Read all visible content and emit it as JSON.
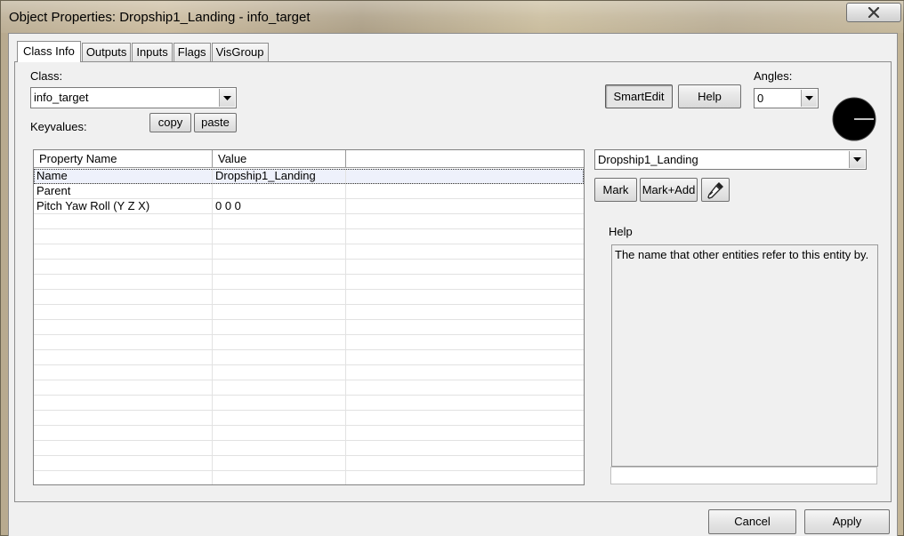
{
  "window": {
    "title": "Object Properties: Dropship1_Landing - info_target",
    "close_label": "close"
  },
  "tabs": [
    {
      "label": "Class Info",
      "active": true
    },
    {
      "label": "Outputs",
      "active": false
    },
    {
      "label": "Inputs",
      "active": false
    },
    {
      "label": "Flags",
      "active": false
    },
    {
      "label": "VisGroup",
      "active": false
    }
  ],
  "class_info": {
    "class_label": "Class:",
    "class_value": "info_target",
    "keyvalues_label": "Keyvalues:",
    "copy_label": "copy",
    "paste_label": "paste",
    "smartedit_label": "SmartEdit",
    "smartedit_pressed": true,
    "help_button_label": "Help",
    "angles_label": "Angles:",
    "angles_value": "0"
  },
  "property_table": {
    "columns": [
      "Property Name",
      "Value"
    ],
    "rows": [
      {
        "name": "Name",
        "value": "Dropship1_Landing",
        "selected": true
      },
      {
        "name": "Parent",
        "value": "",
        "selected": false
      },
      {
        "name": "Pitch Yaw Roll (Y Z X)",
        "value": "0 0 0",
        "selected": false
      }
    ]
  },
  "target": {
    "combo_value": "Dropship1_Landing",
    "mark_label": "Mark",
    "mark_add_label": "Mark+Add",
    "eyedropper_icon": "eyedropper-icon"
  },
  "help": {
    "title": "Help",
    "text": "The name that other entities refer to this entity by."
  },
  "footer": {
    "cancel_label": "Cancel",
    "apply_label": "Apply"
  },
  "colors": {
    "dialog_bg": "#f0f0f0",
    "selection_bg": "#eef1fb"
  }
}
